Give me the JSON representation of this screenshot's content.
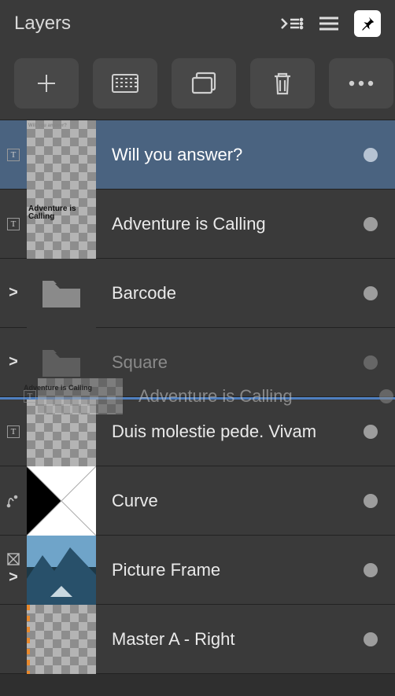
{
  "header": {
    "title": "Layers"
  },
  "toolbar": {
    "add": "add-layer",
    "mask": "mask",
    "group": "group",
    "delete": "delete",
    "more": "more"
  },
  "layers": [
    {
      "name": "Will you answer?",
      "type": "text",
      "selected": true,
      "thumb_label": "Will you answer?",
      "thumb_tiny": true
    },
    {
      "name": "Adventure is Calling",
      "type": "text",
      "selected": false,
      "thumb_label": "Adventure is Calling"
    },
    {
      "name": "Barcode",
      "type": "group",
      "selected": false,
      "expand": ">"
    },
    {
      "name": "Square",
      "type": "group",
      "selected": false,
      "expand": ">",
      "dimmed": true
    },
    {
      "name": "Duis molestie pede. Vivam",
      "type": "text",
      "selected": false
    },
    {
      "name": "Curve",
      "type": "curve",
      "selected": false,
      "curve_badge": true
    },
    {
      "name": "Picture Frame",
      "type": "picture",
      "selected": false,
      "expand": ">",
      "picture_badge": true
    },
    {
      "name": "Master A - Right",
      "type": "master",
      "selected": false
    }
  ],
  "ghost": {
    "name": "Adventure is Calling",
    "thumb_label": "Adventure is Calling"
  },
  "badges": {
    "text": "T"
  }
}
